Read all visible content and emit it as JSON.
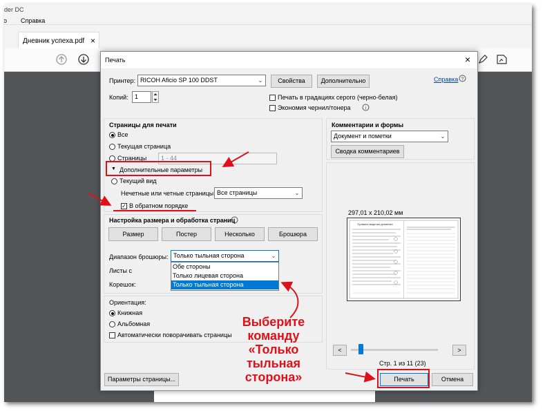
{
  "app": {
    "title_partial": "der DC",
    "menu": [
      "о",
      "Справка"
    ],
    "tab_label": "Дневник успеха.pdf",
    "tab_close": "×"
  },
  "dialog": {
    "title": "Печать",
    "close": "×",
    "printer_label": "Принтер:",
    "printer_value": "RICOH Aficio SP 100 DDST",
    "properties_btn": "Свойства",
    "advanced_btn": "Дополнительно",
    "help_link": "Справка",
    "copies_label": "Копий:",
    "copies_value": "1",
    "grayscale_label": "Печать в градациях серого (черно-белая)",
    "save_ink_label": "Экономия чернил/тонера",
    "pages_section": {
      "title": "Страницы для печати",
      "all": "Все",
      "current": "Текущая страница",
      "pages": "Страницы",
      "pages_placeholder": "1 - 44",
      "more_options": "Дополнительные параметры",
      "current_view": "Текущий вид",
      "odd_even_label": "Нечетные или четные страницы:",
      "odd_even_value": "Все страницы",
      "reverse_label": "В обратном порядке"
    },
    "sizing": {
      "title": "Настройка размера и обработка страниц",
      "buttons": [
        "Размер",
        "Постер",
        "Несколько",
        "Брошюра"
      ],
      "booklet_range_label": "Диапазон брошюры:",
      "booklet_range_value": "Только тыльная сторона",
      "options": [
        "Обе стороны",
        "Только лицевая сторона",
        "Только тыльная сторона"
      ],
      "sheets_label": "Листы с",
      "binding_label": "Корешок:"
    },
    "orientation": {
      "title": "Ориентация:",
      "portrait": "Книжная",
      "landscape": "Альбомная",
      "auto_rotate": "Автоматически поворачивать страницы"
    },
    "comments": {
      "title": "Комментарии и формы",
      "value": "Документ и пометки",
      "summary_btn": "Сводка комментариев"
    },
    "preview": {
      "size": "297,01 x 210,02 мм",
      "page_info": "Стр. 1 из 11 (23)",
      "prev": "<",
      "next": ">"
    },
    "page_setup_btn": "Параметры страницы...",
    "print_btn": "Печать",
    "cancel_btn": "Отмена"
  },
  "annotation": {
    "line1": "Выберите",
    "line2": "команду",
    "line3": "«Только",
    "line4": "тыльная",
    "line5": "сторона»"
  },
  "colors": {
    "accent_red": "#e0101a",
    "highlight_blue": "#0078d7"
  }
}
